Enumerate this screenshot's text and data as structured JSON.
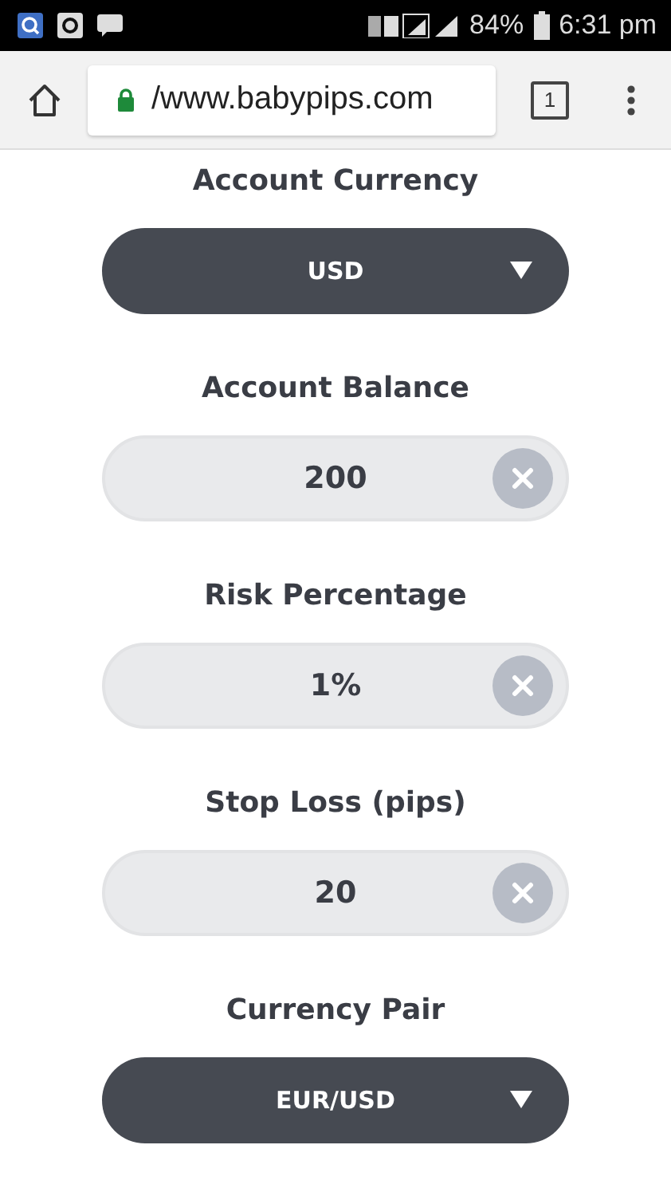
{
  "status_bar": {
    "battery": "84%",
    "time": "6:31 pm"
  },
  "browser": {
    "url": "/www.babypips.com",
    "tab_count": "1"
  },
  "fields": [
    {
      "label": "Account Currency",
      "kind": "select",
      "value": "USD"
    },
    {
      "label": "Account Balance",
      "kind": "input",
      "value": "200"
    },
    {
      "label": "Risk Percentage",
      "kind": "input",
      "value": "1%"
    },
    {
      "label": "Stop Loss (pips)",
      "kind": "input",
      "value": "20"
    },
    {
      "label": "Currency Pair",
      "kind": "select",
      "value": "EUR/USD"
    }
  ]
}
